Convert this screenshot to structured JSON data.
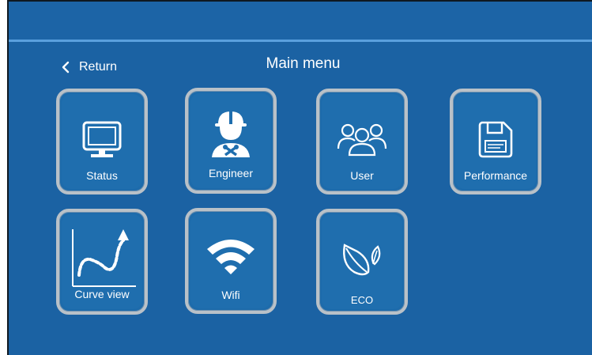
{
  "header": {
    "return_label": "Return",
    "title": "Main menu"
  },
  "menu": {
    "status": {
      "label": "Status",
      "icon": "monitor-icon"
    },
    "engineer": {
      "label": "Engineer",
      "icon": "engineer-icon"
    },
    "user": {
      "label": "User",
      "icon": "users-icon"
    },
    "performance": {
      "label": "Performance",
      "icon": "save-document-icon"
    },
    "curve_view": {
      "label": "Curve view",
      "icon": "curve-chart-icon"
    },
    "wifi": {
      "label": "Wifi",
      "icon": "wifi-icon"
    },
    "eco": {
      "label": "ECO",
      "icon": "leaf-icon"
    }
  },
  "colors": {
    "background": "#1b62a3",
    "tile_border": "#b9c1c8",
    "accent_line": "#5aa0de",
    "text": "#ffffff"
  }
}
